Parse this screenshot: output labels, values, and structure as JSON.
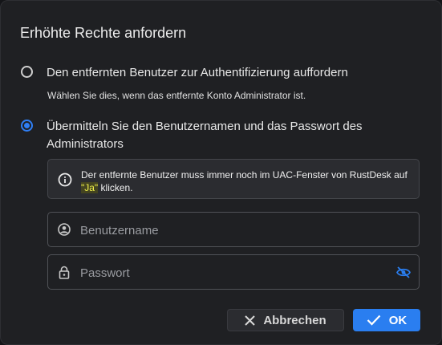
{
  "dialog": {
    "title": "Erhöhte Rechte anfordern",
    "options": [
      {
        "label": "Den entfernten Benutzer zur Authentifizierung auffordern",
        "hint": "Wählen Sie dies, wenn das entfernte Konto Administrator ist.",
        "selected": false
      },
      {
        "label": "Übermitteln Sie den Benutzernamen und das Passwort des Administrators",
        "selected": true
      }
    ],
    "info": {
      "text_before": "Der entfernte Benutzer muss immer noch im UAC-Fenster von RustDesk auf ",
      "highlight": "\"Ja\"",
      "text_after": " klicken."
    },
    "username": {
      "placeholder": "Benutzername",
      "value": ""
    },
    "password": {
      "placeholder": "Passwort",
      "value": ""
    },
    "buttons": {
      "cancel": "Abbrechen",
      "ok": "OK"
    },
    "colors": {
      "accent": "#2a7ef0",
      "background": "#1f2023"
    }
  }
}
